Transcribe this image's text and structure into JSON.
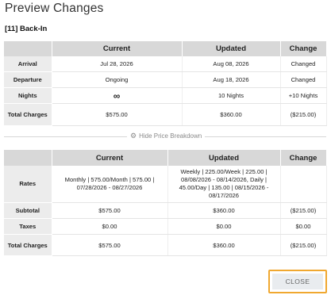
{
  "dialog": {
    "title": "Preview Changes",
    "subtitle": "[11] Back-In"
  },
  "summary": {
    "headers": [
      "",
      "Current",
      "Updated",
      "Change"
    ],
    "rows": [
      {
        "label": "Arrival",
        "current": "Jul 28, 2026",
        "updated": "Aug 08, 2026",
        "change": "Changed"
      },
      {
        "label": "Departure",
        "current": "Ongoing",
        "updated": "Aug 18, 2026",
        "change": "Changed"
      },
      {
        "label": "Nights",
        "current": "∞",
        "current_icon": "infinity-icon",
        "updated": "10 Nights",
        "change": "+10 Nights"
      },
      {
        "label": "Total Charges",
        "current": "$575.00",
        "updated": "$360.00",
        "change": "($215.00)"
      }
    ]
  },
  "breakdown_toggle": {
    "icon": "gear-icon",
    "label": "Hide Price Breakdown"
  },
  "breakdown": {
    "headers": [
      "",
      "Current",
      "Updated",
      "Change"
    ],
    "rows": [
      {
        "label": "Rates",
        "current": "Monthly | 575.00/Month | 575.00 | 07/28/2026 - 08/27/2026",
        "updated": "Weekly | 225.00/Week | 225.00 | 08/08/2026 - 08/14/2026, Daily | 45.00/Day | 135.00 | 08/15/2026 - 08/17/2026",
        "change": ""
      },
      {
        "label": "Subtotal",
        "current": "$575.00",
        "updated": "$360.00",
        "change": "($215.00)"
      },
      {
        "label": "Taxes",
        "current": "$0.00",
        "updated": "$0.00",
        "change": "$0.00"
      },
      {
        "label": "Total Charges",
        "current": "$575.00",
        "updated": "$360.00",
        "change": "($215.00)"
      }
    ]
  },
  "actions": {
    "close_label": "CLOSE",
    "highlight_color": "#f0a830"
  }
}
